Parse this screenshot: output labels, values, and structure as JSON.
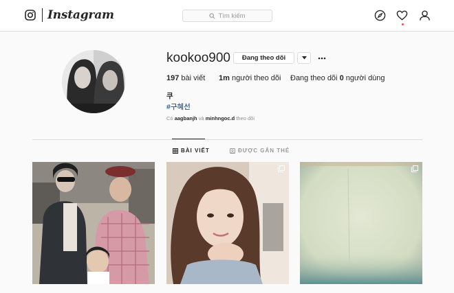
{
  "nav": {
    "brand": "Instagram",
    "search_placeholder": "Tìm kiếm",
    "icons": [
      "instagram-camera-icon",
      "search-icon",
      "compass-icon",
      "heart-icon",
      "person-icon"
    ],
    "notification_dot_color": "#ed4956"
  },
  "profile": {
    "username": "kookoo900",
    "follow_button_label": "Đang theo dõi",
    "posts_count": "197",
    "posts_label": "bài viết",
    "followers_count": "1m",
    "followers_label": "người theo dõi",
    "following_prefix": "Đang theo dõi",
    "following_count": "0",
    "following_suffix": "người dùng",
    "full_name": "쿠",
    "bio_hashtag": "#구혜선",
    "followed_by_prefix": "Có",
    "followed_by_user1": "aagbanjh",
    "followed_by_and": "và",
    "followed_by_user2": "minhngoc.d",
    "followed_by_suffix": "theo dõi"
  },
  "tabs": [
    {
      "label": "BÀI VIẾT",
      "icon": "grid-icon",
      "active": true
    },
    {
      "label": "ĐƯỢC GẮN THẺ",
      "icon": "tag-icon",
      "active": false
    }
  ],
  "posts": [
    {
      "badge": null
    },
    {
      "badge": "multiple-photos-icon"
    },
    {
      "badge": "multiple-photos-icon"
    }
  ],
  "colors": {
    "link": "#003569",
    "border": "#dbdbdb",
    "background": "#fafafa",
    "muted_text": "#8e8e8e"
  }
}
